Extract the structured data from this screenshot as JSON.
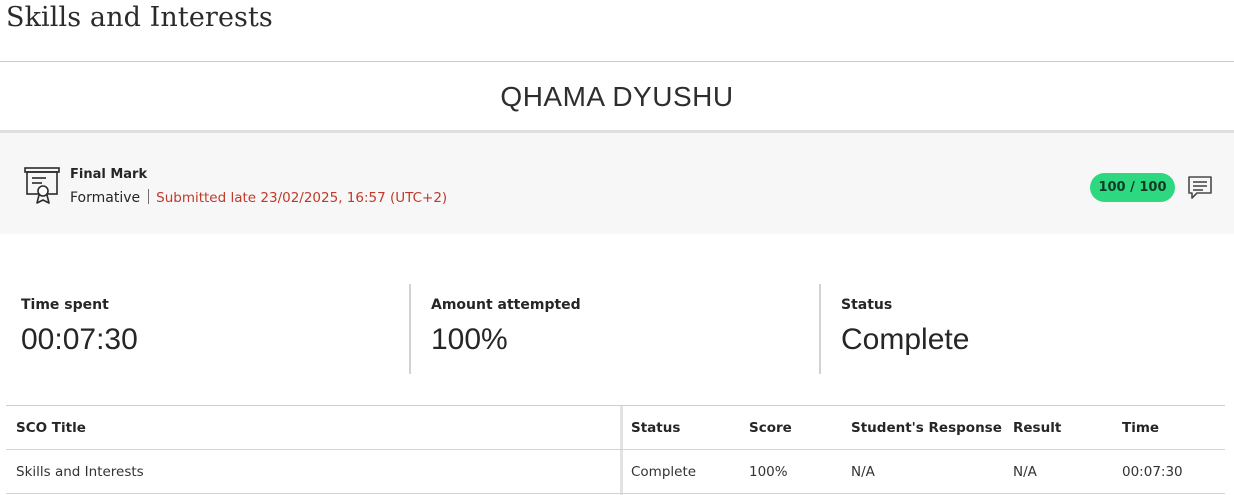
{
  "page": {
    "title": "Skills and Interests"
  },
  "student": {
    "name": "QHAMA DYUSHU"
  },
  "grade": {
    "title": "Final Mark",
    "type": "Formative",
    "submission_status": "Submitted late 23/02/2025, 16:57 (UTC+2)",
    "score": "100 / 100",
    "icons": {
      "item": "certificate-icon",
      "feedback": "comment-icon"
    },
    "colors": {
      "score_badge": "#2dd881",
      "late": "#c0392b"
    }
  },
  "stats": [
    {
      "label": "Time spent",
      "value": "00:07:30"
    },
    {
      "label": "Amount attempted",
      "value": "100%"
    },
    {
      "label": "Status",
      "value": "Complete"
    }
  ],
  "sco_table": {
    "headers": [
      "SCO Title",
      "Status",
      "Score",
      "Student's Response",
      "Result",
      "Time"
    ],
    "rows": [
      [
        "Skills and Interests",
        "Complete",
        "100%",
        "N/A",
        "N/A",
        "00:07:30"
      ]
    ]
  }
}
